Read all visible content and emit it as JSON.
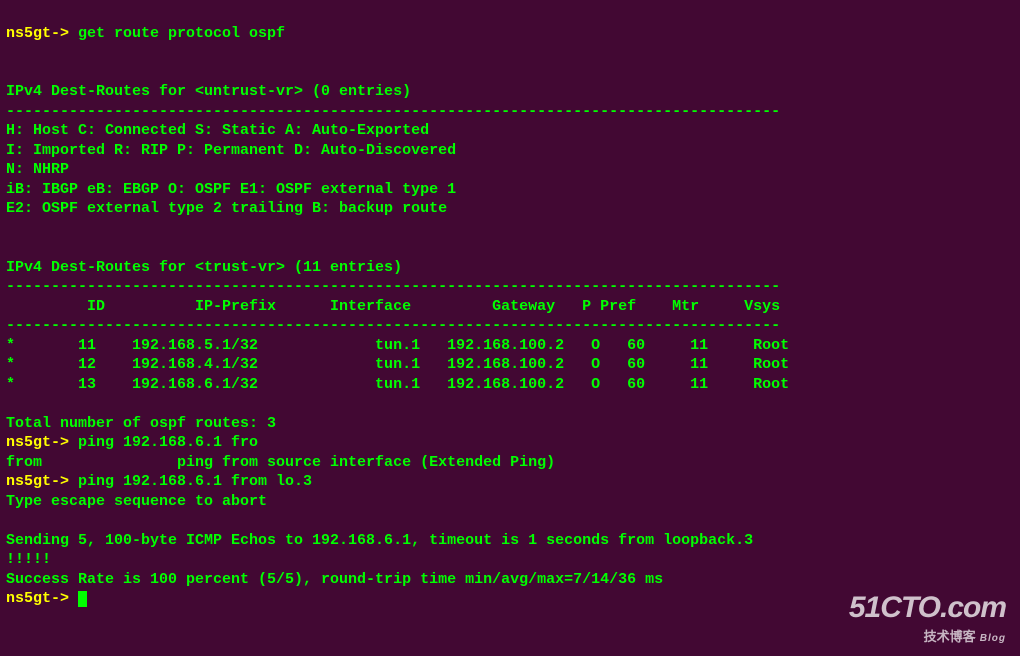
{
  "prompt": "ns5gt-> ",
  "cmd1": "get route protocol ospf",
  "blank": "",
  "sec1_head": "IPv4 Dest-Routes for <untrust-vr> (0 entries)",
  "dash": "--------------------------------------------------------------------------------------",
  "legend1": "H: Host C: Connected S: Static A: Auto-Exported",
  "legend2": "I: Imported R: RIP P: Permanent D: Auto-Discovered",
  "legend3": "N: NHRP",
  "legend4": "iB: IBGP eB: EBGP O: OSPF E1: OSPF external type 1",
  "legend5": "E2: OSPF external type 2 trailing B: backup route",
  "sec2_head": "IPv4 Dest-Routes for <trust-vr> (11 entries)",
  "tbl_hdr": "         ID          IP-Prefix      Interface         Gateway   P Pref    Mtr     Vsys",
  "routes": [
    {
      "star": "*",
      "id": "11",
      "prefix": "192.168.5.1/32",
      "iface": "tun.1",
      "gw": "192.168.100.2",
      "p": "O",
      "pref": "60",
      "mtr": "11",
      "vsys": "Root"
    },
    {
      "star": "*",
      "id": "12",
      "prefix": "192.168.4.1/32",
      "iface": "tun.1",
      "gw": "192.168.100.2",
      "p": "O",
      "pref": "60",
      "mtr": "11",
      "vsys": "Root"
    },
    {
      "star": "*",
      "id": "13",
      "prefix": "192.168.6.1/32",
      "iface": "tun.1",
      "gw": "192.168.100.2",
      "p": "O",
      "pref": "60",
      "mtr": "11",
      "vsys": "Root"
    }
  ],
  "total": "Total number of ospf routes: 3",
  "cmd2": "ping 192.168.6.1 fro",
  "hint": "from               ping from source interface (Extended Ping)",
  "cmd3": "ping 192.168.6.1 from lo.3",
  "escape": "Type escape sequence to abort",
  "sending": "Sending 5, 100-byte ICMP Echos to 192.168.6.1, timeout is 1 seconds from loopback.3",
  "bang": "!!!!!",
  "success": "Success Rate is 100 percent (5/5), round-trip time min/avg/max=7/14/36 ms",
  "wm_big": "51CTO.com",
  "wm_small": "技术博客",
  "wm_blog": "Blog",
  "chart_data": null
}
